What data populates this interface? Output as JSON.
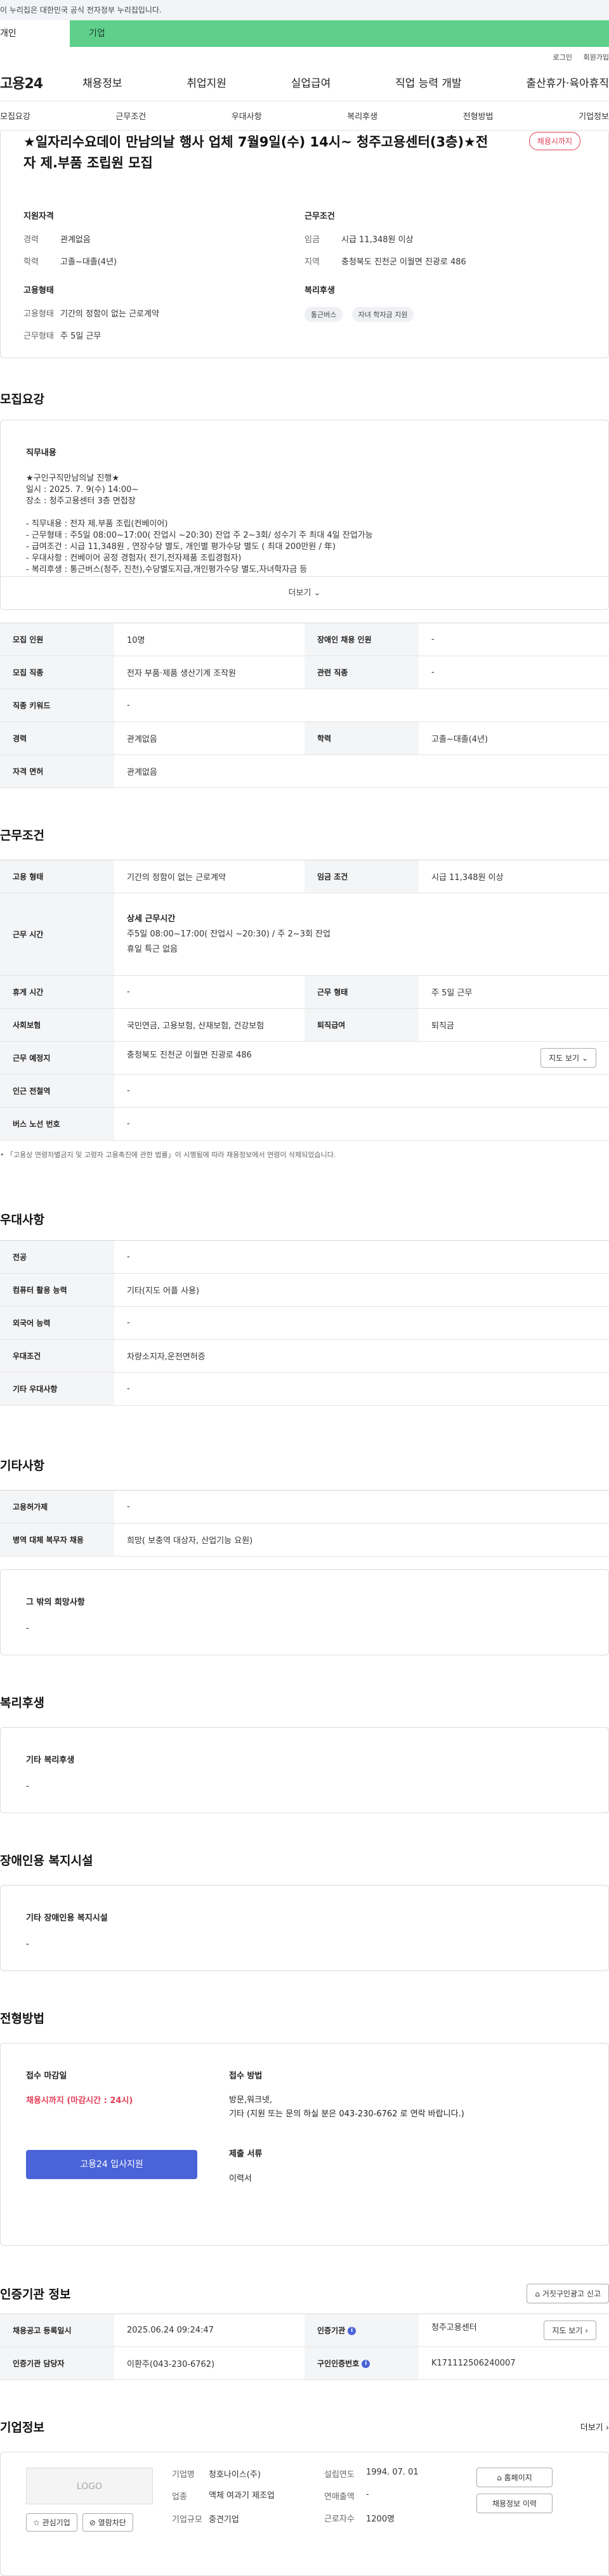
{
  "banner": {
    "text": "이 누리집은 대한민국 공식 전자정부 누리집입니다."
  },
  "site_tabs": [
    "개인",
    "기업"
  ],
  "util": [
    "로그인",
    "회원가입"
  ],
  "gnb": {
    "logo": "고용24",
    "items": [
      "채용정보",
      "취업지원",
      "실업급여",
      "직업 능력 개발",
      "출산휴가·육아휴직"
    ]
  },
  "subnav": [
    "모집요강",
    "근무조건",
    "우대사항",
    "복리후생",
    "전형방법",
    "기업정보"
  ],
  "job": {
    "title": "★일자리수요데이 만남의날 행사 업체 7월9일(수) 14시~ 청주고용센터(3층)★전자 제.부품 조립원 모집",
    "deadline_badge": "채용시까지",
    "qual_h": "지원자격",
    "qual": [
      {
        "k": "경력",
        "v": "관계없음"
      },
      {
        "k": "학력",
        "v": "고졸~대졸(4년)"
      }
    ],
    "type_h": "고용형태",
    "types": [
      {
        "k": "고용형태",
        "v": "기간의 정함이 없는 근로계약"
      },
      {
        "k": "근무형태",
        "v": "주 5일 근무"
      }
    ],
    "cond_h": "근무조건",
    "conds": [
      {
        "k": "임금",
        "v": "시급 11,348원 이상"
      },
      {
        "k": "지역",
        "v": "충청북도 진천군 이월면 진광로 486"
      }
    ],
    "welfare_h": "복리후생",
    "welfare_chips": [
      "통근버스",
      "자녀 학자금 지원"
    ]
  },
  "recruit": {
    "h": "모집요강",
    "detail_title": "직무내용",
    "detail_text": "★구인구직만남의날 진행★\n일시 : 2025. 7. 9(수) 14:00~\n장소 : 청주고용센터 3층 면접장\n\n- 직무내용 : 전자 제.부품 조립(컨베이어)\n- 근무형태 : 주5일 08:00~17:00( 잔업시 ~20:30) 잔업 주 2~3회/ 성수기 주 최대 4일 잔업가능\n- 급여조건 : 시급 11,348원 , 연장수당 별도, 개인별 평가수당 별도 ( 최대 200만원 / 年)\n- 우대사항 : 컨베이어 공정 경험자( 전기,전자제품 조립경험자)\n- 복리후생 : 통근버스(청주, 진천),수당별도지급,개인평가수당 별도,자녀학자금 등",
    "more": "더보기",
    "rows": [
      [
        [
          "모집 인원",
          "10명"
        ],
        [
          "장애인 채용 인원",
          "-"
        ]
      ],
      [
        [
          "모집 직종",
          "전자 부품·제품 생산기계 조작원"
        ],
        [
          "관련 직종",
          "-"
        ]
      ],
      [
        [
          "직종 키워드",
          "-"
        ]
      ],
      [
        [
          "경력",
          "관계없음"
        ],
        [
          "학력",
          "고졸~대졸(4년)"
        ]
      ],
      [
        [
          "자격 면허",
          "관계없음"
        ]
      ]
    ]
  },
  "workcond": {
    "h": "근무조건",
    "emp_type_k": "고용 형태",
    "emp_type_v": "기간의 정함이 없는 근로계약",
    "wage_k": "임금 조건",
    "wage_v": "시급 11,348원 이상",
    "time_k": "근무 시간",
    "time_title": "상세 근무시간",
    "time_line1": "주5일 08:00~17:00( 잔업시 ~20:30) / 주 2~3회 잔업",
    "time_line2": "휴일 특근 없음",
    "break_k": "휴게 시간",
    "break_v": "-",
    "worktype_k": "근무 형태",
    "worktype_v": "주 5일 근무",
    "ins_k": "사회보험",
    "ins_v": "국민연금, 고용보험, 산재보험, 건강보험",
    "sev_k": "퇴직급여",
    "sev_v": "퇴직금",
    "place_k": "근무 예정지",
    "place_v": "충청북도 진천군 이월면 진광로 486",
    "map_btn": "지도 보기",
    "subway_k": "인근 전철역",
    "subway_v": "-",
    "bus_k": "버스 노선 번호",
    "bus_v": "-",
    "note": "「고용상 연령차별금지 및 고령자 고용촉진에 관한 법률」이 시행됨에 따라 채용정보에서 연령이 삭제되었습니다."
  },
  "pref": {
    "h": "우대사항",
    "rows": [
      [
        "전공",
        "-"
      ],
      [
        "컴퓨터 활용 능력",
        "기타(지도 어플 사용)"
      ],
      [
        "외국어 능력",
        "-"
      ],
      [
        "우대조건",
        "차량소지자,운전면허증"
      ],
      [
        "기타 우대사항",
        "-"
      ]
    ]
  },
  "etc": {
    "h": "기타사항",
    "rows": [
      [
        "고용허가제",
        "-"
      ],
      [
        "병역 대체 복무자 채용",
        "희망( 보충역 대상자, 산업기능 요원)"
      ]
    ],
    "box_title": "그 밖의 희망사항",
    "box_value": "-"
  },
  "benefit": {
    "h": "복리후생",
    "box_title": "기타 복리후생",
    "box_value": "-"
  },
  "disab": {
    "h": "장애인용 복지시설",
    "box_title": "기타 장애인용 복지시설",
    "box_value": "-"
  },
  "apply": {
    "h": "전형방법",
    "deadline_h": "접수 마감일",
    "deadline_v": "채용시까지 (마감시간 : 24시)",
    "apply_btn": "고용24 입사지원",
    "method_h": "접수 방법",
    "method_v1": "방문,워크넷,",
    "method_v2": "기타 (지원 또는 문의 하실 분은 043-230-6762 로 연락 바랍니다.)",
    "docs_h": "제출 서류",
    "docs_v": "이력서"
  },
  "agency": {
    "h": "인증기관 정보",
    "report_btn": "거짓구인광고 신고",
    "reg_k": "채용공고 등록일시",
    "reg_v": "2025.06.24 09:24:47",
    "org_k": "인증기관",
    "org_v": "청주고용센터",
    "map_btn": "지도 보기",
    "mgr_k": "인증기관 담당자",
    "mgr_v": "이환주(043-230-6762)",
    "auth_k": "구인인증번호",
    "auth_v": "K171112506240007"
  },
  "company": {
    "h": "기업정보",
    "more": "더보기",
    "logo": "LOGO",
    "fav_btn": "관심기업",
    "block_btn": "열람차단",
    "name_k": "기업명",
    "name_v": "청호나이스(주)",
    "ind_k": "업종",
    "ind_v": "액체 여과기 제조업",
    "size_k": "기업규모",
    "size_v": "중견기업",
    "est_k": "설립연도",
    "est_v": "1994. 07. 01",
    "sales_k": "연매출액",
    "sales_v": "-",
    "emp_k": "근로자수",
    "emp_v": "1200명",
    "home_btn": "홈페이지",
    "hist_btn": "채용정보 이력"
  },
  "colors": {
    "accent": "#4a63d8",
    "biz_green": "#5fcf8b",
    "danger": "#e23e57"
  }
}
